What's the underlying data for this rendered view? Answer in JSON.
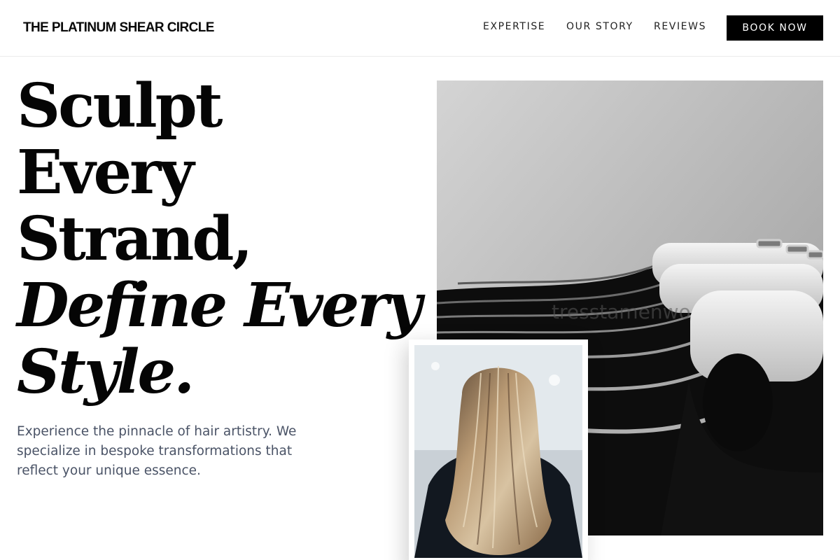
{
  "header": {
    "brand": "THE PLATINUM SHEAR CIRCLE",
    "nav": [
      "EXPERTISE",
      "OUR STORY",
      "REVIEWS"
    ],
    "cta_label": "BOOK NOW"
  },
  "hero": {
    "headline_lines": [
      "Sculpt",
      "Every",
      "Strand,"
    ],
    "headline_italic_lines": [
      "Define Every",
      "Style."
    ],
    "subcopy": "Experience the pinnacle of hair artistry. We specialize in bespoke transformations that reflect your unique essence."
  },
  "images": {
    "main_watermark": "tresstamenwo",
    "main_subject": "salon washing stations",
    "inset_subject": "long highlighted hair from behind"
  },
  "colors": {
    "cta_bg": "#000000",
    "cta_text": "#ffffff",
    "body_text": "#4a5366"
  }
}
